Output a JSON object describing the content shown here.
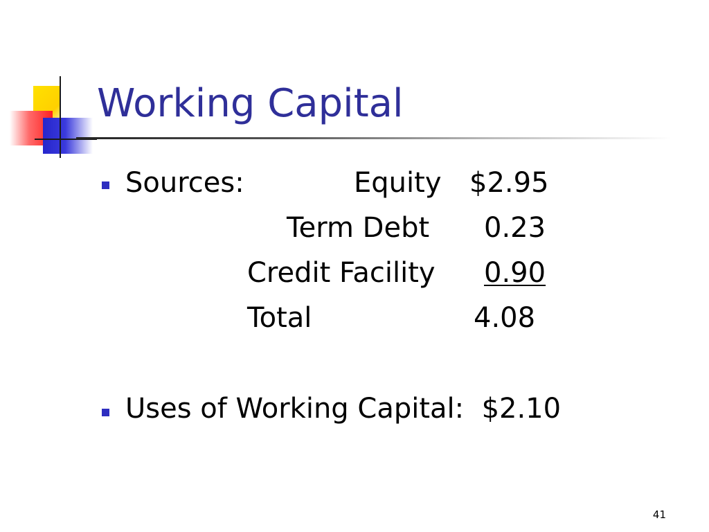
{
  "slide": {
    "title": "Working Capital",
    "page_number": "41"
  },
  "sources": {
    "label": "Sources:",
    "rows": [
      {
        "label": "Equity",
        "value": "$2.95"
      },
      {
        "label": "Term Debt",
        "value": "0.23"
      },
      {
        "label": "Credit Facility",
        "value": "0.90"
      },
      {
        "label": "Total",
        "value": "4.08"
      }
    ]
  },
  "uses": {
    "text": "Uses of Working Capital:  $2.10"
  },
  "colors": {
    "title": "#2f2f99",
    "bullet": "#2e2ec0"
  }
}
